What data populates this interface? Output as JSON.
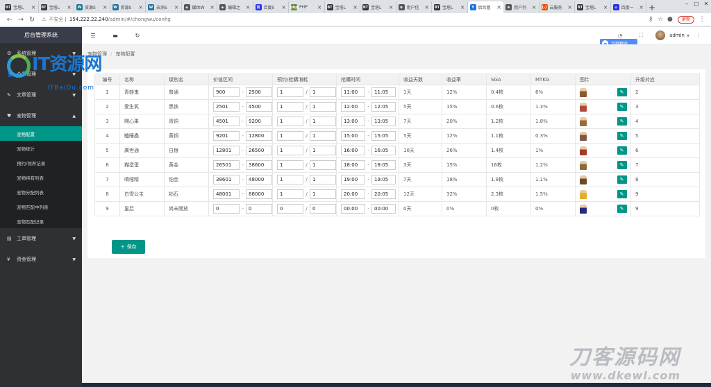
{
  "browser": {
    "tabs": [
      {
        "icon": "BT",
        "title": "宝塔L",
        "color": "#333"
      },
      {
        "icon": "BT",
        "title": "宝塔L",
        "color": "#333"
      },
      {
        "icon": "W",
        "title": "资源S",
        "color": "#21759b"
      },
      {
        "icon": "W",
        "title": "资源S",
        "color": "#21759b"
      },
      {
        "icon": "W",
        "title": "亲测S",
        "color": "#21759b"
      },
      {
        "icon": "◈",
        "title": "媒体W",
        "color": "#555"
      },
      {
        "icon": "◈",
        "title": "编辑之",
        "color": "#555"
      },
      {
        "icon": "百",
        "title": "百度S",
        "color": "#2932e1"
      },
      {
        "icon": "php",
        "title": "PHP",
        "color": "#6a8a3a"
      },
      {
        "icon": "BT",
        "title": "宝塔L",
        "color": "#333"
      },
      {
        "icon": "BT",
        "title": "宝塔L",
        "color": "#333"
      },
      {
        "icon": "⊕",
        "title": "用户信",
        "color": "#555"
      },
      {
        "icon": "BT",
        "title": "宝塔L",
        "color": "#333"
      },
      {
        "icon": "Y",
        "title": "后台管",
        "color": "#1a73e8",
        "active": true
      },
      {
        "icon": "⊕",
        "title": "用户列",
        "color": "#555"
      },
      {
        "icon": "[-]",
        "title": "云服务",
        "color": "#e65100"
      },
      {
        "icon": "BT",
        "title": "宝塔L",
        "color": "#333"
      },
      {
        "icon": "⌂",
        "title": "百度一",
        "color": "#2932e1"
      }
    ],
    "security": "不安全",
    "url": "154.222.22.240",
    "url_path": "/admin/#/chongwu/config",
    "update_label": "更新"
  },
  "sidebar": {
    "title": "后台管理系统",
    "menus": [
      {
        "icon": "⚙",
        "label": "系统管理"
      },
      {
        "icon": "👤",
        "label": "会员管理"
      },
      {
        "icon": "✎",
        "label": "文章管理"
      },
      {
        "icon": "♥",
        "label": "宠物管理",
        "open": true
      }
    ],
    "subs": [
      {
        "label": "宠物配置",
        "active": true
      },
      {
        "label": "宠物统计"
      },
      {
        "label": "预约/领养记录"
      },
      {
        "label": "宠物持有列表"
      },
      {
        "label": "宠物分配列表"
      },
      {
        "label": "宠物匹配中列表"
      },
      {
        "label": "宠物匹配记录"
      }
    ],
    "menus2": [
      {
        "icon": "▤",
        "label": "工单管理"
      },
      {
        "icon": "¥",
        "label": "资金管理"
      }
    ]
  },
  "header": {
    "username": "admin",
    "baidu_label": "百度翻译"
  },
  "breadcrumb": {
    "parent": "宠物管理",
    "current": "宠物配置"
  },
  "table": {
    "columns": [
      "编号",
      "名称",
      "级别名",
      "价值区间",
      "预约/抢購消耗",
      "抢購时间",
      "收益天数",
      "收益率",
      "SGA",
      "MTKG",
      "图片",
      "升级对应"
    ],
    "rows": [
      {
        "id": "1",
        "name": "青蛙鬼",
        "level": "普通",
        "vmin": "900",
        "vmax": "2500",
        "c1": "1",
        "c2": "1",
        "t1": "11:00",
        "t2": "11:05",
        "days": "1天",
        "rate": "12%",
        "sga": "0.4枚",
        "mtkg": "6%",
        "img": "#8a5a2b",
        "up": "2"
      },
      {
        "id": "2",
        "name": "爱生氧",
        "level": "黑铁",
        "vmin": "2501",
        "vmax": "4500",
        "c1": "1",
        "c2": "1",
        "t1": "12:00",
        "t2": "12:05",
        "days": "5天",
        "rate": "15%",
        "sga": "0.6枚",
        "mtkg": "1.3%",
        "img": "#b04a3a",
        "up": "3"
      },
      {
        "id": "3",
        "name": "開心果",
        "level": "青铜",
        "vmin": "4501",
        "vmax": "9200",
        "c1": "1",
        "c2": "1",
        "t1": "13:00",
        "t2": "13:05",
        "days": "7天",
        "rate": "20%",
        "sga": "1.2枚",
        "mtkg": "1.8%",
        "img": "#9a6b3a",
        "up": "4"
      },
      {
        "id": "4",
        "name": "瞌睡蟲",
        "level": "黄铜",
        "vmin": "9201",
        "vmax": "12800",
        "c1": "1",
        "c2": "1",
        "t1": "15:00",
        "t2": "15:05",
        "days": "5天",
        "rate": "12%",
        "sga": "1.1枚",
        "mtkg": "0.3%",
        "img": "#7a5a4a",
        "up": "5"
      },
      {
        "id": "5",
        "name": "厲世通",
        "level": "白银",
        "vmin": "12801",
        "vmax": "26500",
        "c1": "1",
        "c2": "1",
        "t1": "16:00",
        "t2": "16:05",
        "days": "10天",
        "rate": "26%",
        "sga": "1.4枚",
        "mtkg": "1%",
        "img": "#a03a2a",
        "up": "6"
      },
      {
        "id": "6",
        "name": "糊塗蛋",
        "level": "黄金",
        "vmin": "26501",
        "vmax": "38600",
        "c1": "1",
        "c2": "1",
        "t1": "18:00",
        "t2": "18:05",
        "days": "3天",
        "rate": "15%",
        "sga": "16枚",
        "mtkg": "1.2%",
        "img": "#8a6a3a",
        "up": "7"
      },
      {
        "id": "7",
        "name": "噴嚏精",
        "level": "铂金",
        "vmin": "38601",
        "vmax": "48000",
        "c1": "1",
        "c2": "1",
        "t1": "19:00",
        "t2": "19:05",
        "days": "7天",
        "rate": "18%",
        "sga": "1.8枚",
        "mtkg": "1.1%",
        "img": "#6a4a2a",
        "up": "8"
      },
      {
        "id": "8",
        "name": "白雪公主",
        "level": "钻石",
        "vmin": "48001",
        "vmax": "88000",
        "c1": "1",
        "c2": "1",
        "t1": "20:00",
        "t2": "20:05",
        "days": "12天",
        "rate": "32%",
        "sga": "2.3枚",
        "mtkg": "1.5%",
        "img": "#e0b020",
        "up": "9"
      },
      {
        "id": "9",
        "name": "皇后",
        "level": "尚未開放",
        "vmin": "0",
        "vmax": "0",
        "c1": "0",
        "c2": "0",
        "t1": "00:00",
        "t2": "00:00",
        "days": "0天",
        "rate": "0%",
        "sga": "0枚",
        "mtkg": "0%",
        "img": "#2a2a7a",
        "up": "9"
      }
    ]
  },
  "save_label": "保存",
  "watermark": {
    "brand": "IT资源网",
    "sub": "ITBaiDu.com",
    "brand2": "刀客源码网",
    "sub2": "www.dkewl.com"
  }
}
